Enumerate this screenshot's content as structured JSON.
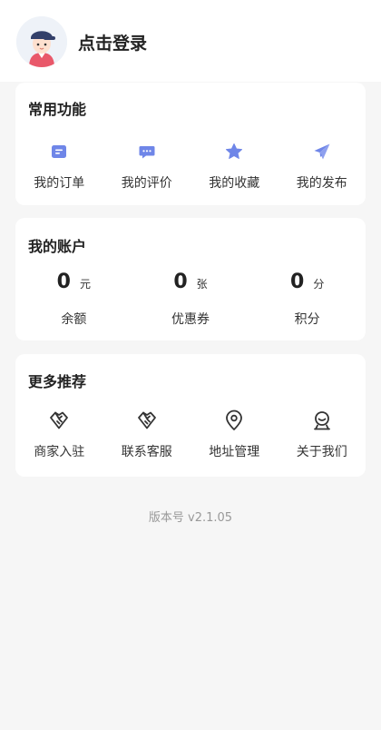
{
  "header": {
    "login_label": "点击登录"
  },
  "common": {
    "title": "常用功能",
    "items": [
      {
        "label": "我的订单",
        "icon": "order-icon"
      },
      {
        "label": "我的评价",
        "icon": "comment-icon"
      },
      {
        "label": "我的收藏",
        "icon": "star-icon"
      },
      {
        "label": "我的发布",
        "icon": "send-icon"
      }
    ],
    "icon_color": "#6f86e8"
  },
  "account": {
    "title": "我的账户",
    "items": [
      {
        "value": "0",
        "unit": "元",
        "label": "余额"
      },
      {
        "value": "0",
        "unit": "张",
        "label": "优惠券"
      },
      {
        "value": "0",
        "unit": "分",
        "label": "积分"
      }
    ]
  },
  "more": {
    "title": "更多推荐",
    "items": [
      {
        "label": "商家入驻",
        "icon": "handshake-icon"
      },
      {
        "label": "联系客服",
        "icon": "handshake-icon"
      },
      {
        "label": "地址管理",
        "icon": "location-icon"
      },
      {
        "label": "关于我们",
        "icon": "about-icon"
      }
    ]
  },
  "footer": {
    "version": "版本号 v2.1.05"
  }
}
